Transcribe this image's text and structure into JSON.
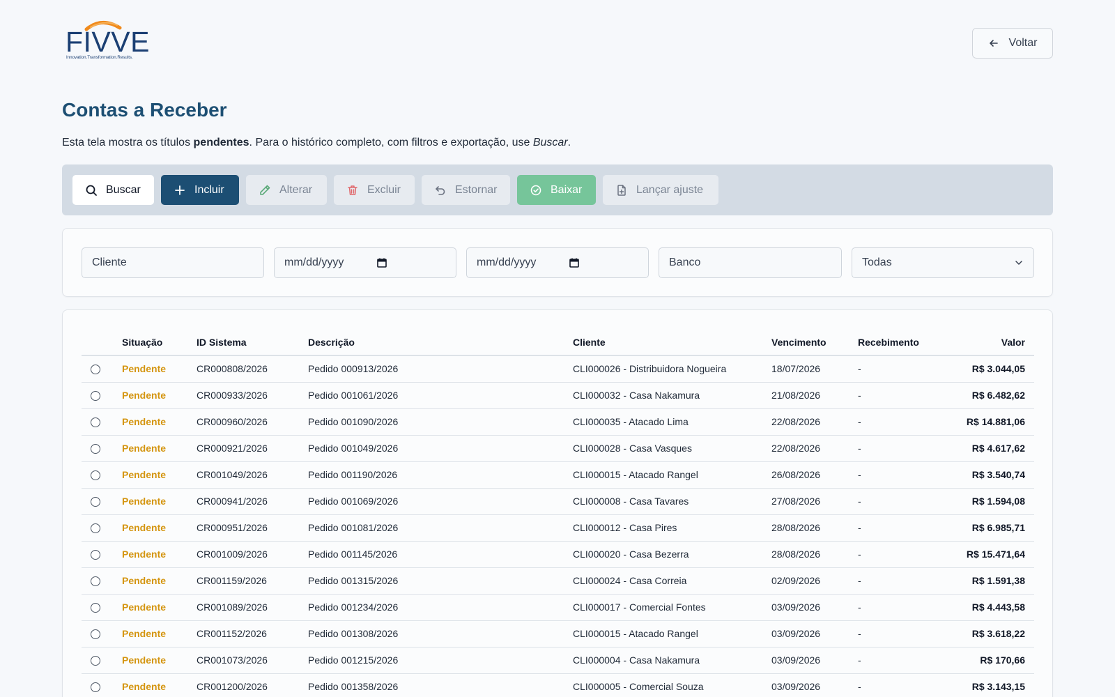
{
  "logo": {
    "name": "FIVVE",
    "tagline": "Innovation.Transformation.Results."
  },
  "header": {
    "back_label": "Voltar"
  },
  "page": {
    "title": "Contas a Receber",
    "subtitle_pre": "Esta tela mostra os títulos ",
    "subtitle_bold": "pendentes",
    "subtitle_mid": ". Para o histórico completo, com filtros e exportação, use ",
    "subtitle_italic": "Buscar",
    "subtitle_end": "."
  },
  "toolbar": {
    "buscar": "Buscar",
    "incluir": "Incluir",
    "alterar": "Alterar",
    "excluir": "Excluir",
    "estornar": "Estornar",
    "baixar": "Baixar",
    "lancar_ajuste": "Lançar ajuste"
  },
  "filters": {
    "cliente_placeholder": "Cliente",
    "date_from_placeholder": "mm/dd/yyyy",
    "date_to_placeholder": "mm/dd/yyyy",
    "banco_placeholder": "Banco",
    "status_selected": "Todas"
  },
  "table": {
    "columns": [
      "Situação",
      "ID Sistema",
      "Descrição",
      "Cliente",
      "Vencimento",
      "Recebimento",
      "Valor"
    ],
    "rows": [
      {
        "situacao": "Pendente",
        "id": "CR000808/2026",
        "descricao": "Pedido 000913/2026",
        "cliente": "CLI000026 - Distribuidora Nogueira",
        "vencimento": "18/07/2026",
        "recebimento": "-",
        "valor": "R$ 3.044,05"
      },
      {
        "situacao": "Pendente",
        "id": "CR000933/2026",
        "descricao": "Pedido 001061/2026",
        "cliente": "CLI000032 - Casa Nakamura",
        "vencimento": "21/08/2026",
        "recebimento": "-",
        "valor": "R$ 6.482,62"
      },
      {
        "situacao": "Pendente",
        "id": "CR000960/2026",
        "descricao": "Pedido 001090/2026",
        "cliente": "CLI000035 - Atacado Lima",
        "vencimento": "22/08/2026",
        "recebimento": "-",
        "valor": "R$ 14.881,06"
      },
      {
        "situacao": "Pendente",
        "id": "CR000921/2026",
        "descricao": "Pedido 001049/2026",
        "cliente": "CLI000028 - Casa Vasques",
        "vencimento": "22/08/2026",
        "recebimento": "-",
        "valor": "R$ 4.617,62"
      },
      {
        "situacao": "Pendente",
        "id": "CR001049/2026",
        "descricao": "Pedido 001190/2026",
        "cliente": "CLI000015 - Atacado Rangel",
        "vencimento": "26/08/2026",
        "recebimento": "-",
        "valor": "R$ 3.540,74"
      },
      {
        "situacao": "Pendente",
        "id": "CR000941/2026",
        "descricao": "Pedido 001069/2026",
        "cliente": "CLI000008 - Casa Tavares",
        "vencimento": "27/08/2026",
        "recebimento": "-",
        "valor": "R$ 1.594,08"
      },
      {
        "situacao": "Pendente",
        "id": "CR000951/2026",
        "descricao": "Pedido 001081/2026",
        "cliente": "CLI000012 - Casa Pires",
        "vencimento": "28/08/2026",
        "recebimento": "-",
        "valor": "R$ 6.985,71"
      },
      {
        "situacao": "Pendente",
        "id": "CR001009/2026",
        "descricao": "Pedido 001145/2026",
        "cliente": "CLI000020 - Casa Bezerra",
        "vencimento": "28/08/2026",
        "recebimento": "-",
        "valor": "R$ 15.471,64"
      },
      {
        "situacao": "Pendente",
        "id": "CR001159/2026",
        "descricao": "Pedido 001315/2026",
        "cliente": "CLI000024 - Casa Correia",
        "vencimento": "02/09/2026",
        "recebimento": "-",
        "valor": "R$ 1.591,38"
      },
      {
        "situacao": "Pendente",
        "id": "CR001089/2026",
        "descricao": "Pedido 001234/2026",
        "cliente": "CLI000017 - Comercial Fontes",
        "vencimento": "03/09/2026",
        "recebimento": "-",
        "valor": "R$ 4.443,58"
      },
      {
        "situacao": "Pendente",
        "id": "CR001152/2026",
        "descricao": "Pedido 001308/2026",
        "cliente": "CLI000015 - Atacado Rangel",
        "vencimento": "03/09/2026",
        "recebimento": "-",
        "valor": "R$ 3.618,22"
      },
      {
        "situacao": "Pendente",
        "id": "CR001073/2026",
        "descricao": "Pedido 001215/2026",
        "cliente": "CLI000004 - Casa Nakamura",
        "vencimento": "03/09/2026",
        "recebimento": "-",
        "valor": "R$ 170,66"
      },
      {
        "situacao": "Pendente",
        "id": "CR001200/2026",
        "descricao": "Pedido 001358/2026",
        "cliente": "CLI000005 - Comercial Souza",
        "vencimento": "03/09/2026",
        "recebimento": "-",
        "valor": "R$ 3.143,15"
      }
    ]
  },
  "colors": {
    "primary": "#1c4e73",
    "title": "#1d4f73",
    "status_pending": "#d49510",
    "success": "#76c59a",
    "toolbar_bg": "#d3dbe4"
  }
}
